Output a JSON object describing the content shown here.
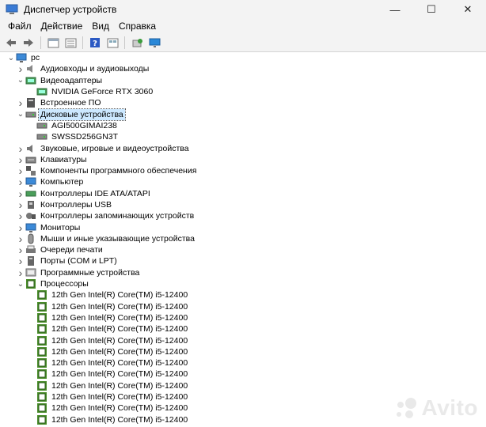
{
  "window": {
    "title": "Диспетчер устройств"
  },
  "menu": [
    "Файл",
    "Действие",
    "Вид",
    "Справка"
  ],
  "toolbar_icons": [
    "back-arrow-icon",
    "forward-arrow-icon",
    "properties-icon",
    "list-icon",
    "help-icon",
    "view-icon",
    "scan-icon",
    "monitor-icon"
  ],
  "tree": {
    "root": "pc",
    "items": [
      {
        "label": "Аудиовходы и аудиовыходы",
        "icon": "speaker-icon",
        "expanded": false
      },
      {
        "label": "Видеоадаптеры",
        "icon": "display-adapter-icon",
        "expanded": true,
        "children": [
          "NVIDIA GeForce RTX 3060"
        ]
      },
      {
        "label": "Встроенное ПО",
        "icon": "firmware-icon",
        "expanded": false
      },
      {
        "label": "Дисковые устройства",
        "icon": "disk-icon",
        "expanded": true,
        "selected": true,
        "children": [
          "AGI500GIMAI238",
          "SWSSD256GN3T"
        ]
      },
      {
        "label": "Звуковые, игровые и видеоустройства",
        "icon": "sound-icon",
        "expanded": false
      },
      {
        "label": "Клавиатуры",
        "icon": "keyboard-icon",
        "expanded": false
      },
      {
        "label": "Компоненты программного обеспечения",
        "icon": "software-component-icon",
        "expanded": false
      },
      {
        "label": "Компьютер",
        "icon": "computer-icon",
        "expanded": false
      },
      {
        "label": "Контроллеры IDE ATA/ATAPI",
        "icon": "ide-controller-icon",
        "expanded": false
      },
      {
        "label": "Контроллеры USB",
        "icon": "usb-icon",
        "expanded": false
      },
      {
        "label": "Контроллеры запоминающих устройств",
        "icon": "storage-controller-icon",
        "expanded": false
      },
      {
        "label": "Мониторы",
        "icon": "monitor-icon",
        "expanded": false
      },
      {
        "label": "Мыши и иные указывающие устройства",
        "icon": "mouse-icon",
        "expanded": false
      },
      {
        "label": "Очереди печати",
        "icon": "printer-icon",
        "expanded": false
      },
      {
        "label": "Порты (COM и LPT)",
        "icon": "port-icon",
        "expanded": false
      },
      {
        "label": "Программные устройства",
        "icon": "software-device-icon",
        "expanded": false
      },
      {
        "label": "Процессоры",
        "icon": "processor-icon",
        "expanded": true,
        "children": [
          "12th Gen Intel(R) Core(TM) i5-12400",
          "12th Gen Intel(R) Core(TM) i5-12400",
          "12th Gen Intel(R) Core(TM) i5-12400",
          "12th Gen Intel(R) Core(TM) i5-12400",
          "12th Gen Intel(R) Core(TM) i5-12400",
          "12th Gen Intel(R) Core(TM) i5-12400",
          "12th Gen Intel(R) Core(TM) i5-12400",
          "12th Gen Intel(R) Core(TM) i5-12400",
          "12th Gen Intel(R) Core(TM) i5-12400",
          "12th Gen Intel(R) Core(TM) i5-12400",
          "12th Gen Intel(R) Core(TM) i5-12400",
          "12th Gen Intel(R) Core(TM) i5-12400"
        ]
      }
    ]
  },
  "watermark": {
    "text": "Avito"
  }
}
